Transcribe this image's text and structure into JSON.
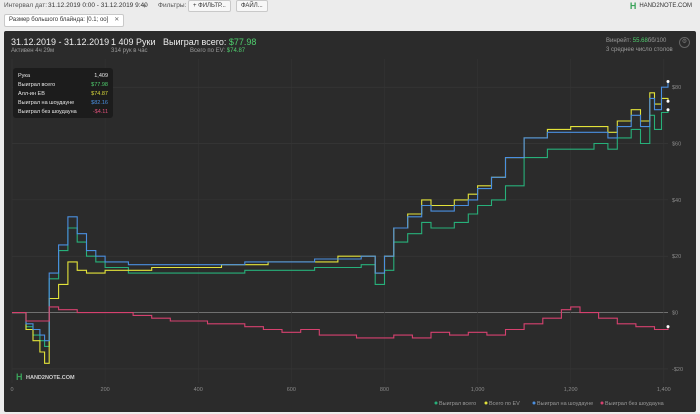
{
  "toolbar": {
    "date_label": "Интервал дат:",
    "date_value": "31.12.2019 0:00 - 31.12.2019 9:40",
    "filters_label": "Фильтры:",
    "filter_button": "+ ФИЛЬТР...",
    "file_button": "ФАЙЛ..."
  },
  "brand": {
    "name": "HAND2NOTE.COM"
  },
  "active_filter": {
    "label": "Размер большого блайнда: [0.1; oo]"
  },
  "summary": {
    "date_range": "31.12.2019 - 31.12.2019",
    "active_time": "Активен 4ч 29м",
    "hands": "1 409 Руки",
    "hands_rate": "314 рук в час",
    "won_label": "Выиграл всего:",
    "won_value": "$77.98",
    "ev_label": "Всего по EV:",
    "ev_value": "$74.87",
    "winrate_label": "Винрейт:",
    "winrate_value": "55.68",
    "winrate_unit": "бб/100",
    "tables": "3 среднее число столов"
  },
  "tooltip": {
    "rows": [
      {
        "key": "Рука",
        "value": "1,409",
        "color": "#e8e8e8"
      },
      {
        "key": "Выиграл всего",
        "value": "$77.98",
        "color": "#4fcf6e"
      },
      {
        "key": "Алл-ин EB",
        "value": "$74.87",
        "color": "#d8d83a"
      },
      {
        "key": "Выиграл на шоудауне",
        "value": "$82.16",
        "color": "#4a90e2"
      },
      {
        "key": "Выиграл без шоудауна",
        "value": "-$4.11",
        "color": "#e0507a"
      }
    ]
  },
  "colors": {
    "total": "#27b07a",
    "ev": "#e3e33a",
    "showdown": "#4a8fe0",
    "nonshowdown": "#d6416f"
  },
  "chart_data": {
    "type": "line",
    "x_ticks": [
      "0",
      "200",
      "400",
      "600",
      "800",
      "1,000",
      "1,200",
      "1,400"
    ],
    "y_ticks": [
      "$80",
      "$60",
      "$40",
      "$20",
      "$0",
      "-$20"
    ],
    "xlim": [
      0,
      1409
    ],
    "ylim": [
      -25,
      90
    ],
    "legend_position": "bottom-right",
    "series": [
      {
        "name": "Выиграл всего",
        "color_key": "total",
        "x": [
          0,
          30,
          45,
          60,
          70,
          80,
          100,
          120,
          140,
          160,
          180,
          200,
          250,
          300,
          350,
          400,
          450,
          500,
          550,
          600,
          650,
          700,
          750,
          780,
          800,
          820,
          850,
          880,
          900,
          920,
          950,
          980,
          1000,
          1030,
          1060,
          1100,
          1150,
          1200,
          1250,
          1280,
          1300,
          1330,
          1350,
          1370,
          1380,
          1395,
          1409
        ],
        "y": [
          0,
          -5,
          -8,
          -10,
          -12,
          12,
          22,
          30,
          25,
          20,
          18,
          16,
          14,
          14,
          14,
          14,
          14,
          15,
          15,
          15,
          16,
          16,
          17,
          10,
          15,
          25,
          28,
          32,
          30,
          30,
          32,
          35,
          38,
          40,
          45,
          55,
          58,
          58,
          60,
          58,
          62,
          65,
          60,
          70,
          65,
          71,
          72
        ]
      },
      {
        "name": "Всего по EV",
        "color_key": "ev",
        "x": [
          0,
          30,
          45,
          60,
          70,
          80,
          100,
          120,
          140,
          160,
          180,
          200,
          250,
          300,
          350,
          400,
          450,
          500,
          550,
          600,
          650,
          700,
          750,
          780,
          800,
          820,
          850,
          880,
          900,
          920,
          950,
          980,
          1000,
          1030,
          1060,
          1100,
          1150,
          1200,
          1250,
          1280,
          1300,
          1330,
          1350,
          1370,
          1380,
          1395,
          1409
        ],
        "y": [
          0,
          -6,
          -10,
          -14,
          -18,
          5,
          10,
          18,
          15,
          14,
          14,
          15,
          15,
          16,
          16,
          16,
          17,
          17,
          18,
          18,
          18,
          20,
          20,
          14,
          20,
          30,
          35,
          40,
          38,
          38,
          40,
          42,
          45,
          48,
          55,
          62,
          65,
          66,
          66,
          64,
          68,
          72,
          68,
          78,
          74,
          76,
          75
        ]
      },
      {
        "name": "Выиграл на шоудауне",
        "color_key": "showdown",
        "x": [
          0,
          30,
          45,
          60,
          70,
          80,
          100,
          120,
          140,
          160,
          180,
          200,
          250,
          300,
          350,
          400,
          450,
          500,
          550,
          600,
          650,
          700,
          750,
          780,
          800,
          820,
          850,
          880,
          900,
          920,
          950,
          980,
          1000,
          1030,
          1060,
          1100,
          1150,
          1200,
          1250,
          1280,
          1300,
          1330,
          1350,
          1370,
          1380,
          1395,
          1409
        ],
        "y": [
          0,
          -4,
          -6,
          -8,
          -10,
          14,
          24,
          34,
          28,
          22,
          20,
          18,
          17,
          17,
          17,
          17,
          17,
          18,
          18,
          18,
          19,
          19,
          20,
          14,
          20,
          30,
          34,
          38,
          36,
          36,
          38,
          40,
          44,
          48,
          55,
          62,
          64,
          64,
          64,
          62,
          66,
          70,
          66,
          76,
          72,
          80,
          82
        ]
      },
      {
        "name": "Выиграл без шоудауна",
        "color_key": "nonshowdown",
        "x": [
          0,
          30,
          60,
          80,
          100,
          140,
          180,
          220,
          260,
          300,
          340,
          380,
          420,
          460,
          500,
          540,
          580,
          620,
          660,
          700,
          740,
          780,
          820,
          860,
          900,
          940,
          980,
          1020,
          1060,
          1100,
          1140,
          1180,
          1200,
          1220,
          1260,
          1300,
          1340,
          1380,
          1409
        ],
        "y": [
          0,
          -3,
          -3,
          2,
          1,
          0,
          0,
          0,
          -1,
          -2,
          -3,
          -3,
          -4,
          -4,
          -5,
          -6,
          -7,
          -6,
          -8,
          -8,
          -9,
          -9,
          -8,
          -9,
          -7,
          -8,
          -7,
          -8,
          -6,
          -4,
          -2,
          1,
          2,
          0,
          -2,
          -4,
          -5,
          -6,
          -5
        ]
      }
    ]
  }
}
